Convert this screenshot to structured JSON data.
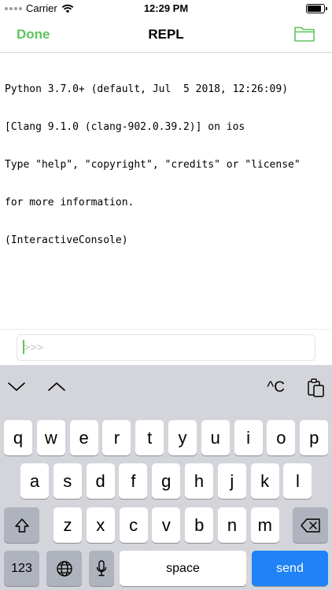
{
  "status_bar": {
    "carrier": "Carrier",
    "time": "12:29 PM",
    "battery_level": 0.95
  },
  "nav": {
    "done_label": "Done",
    "title": "REPL",
    "folder_icon": "folder-icon"
  },
  "console": {
    "lines": [
      "Python 3.7.0+ (default, Jul  5 2018, 12:26:09)",
      "[Clang 9.1.0 (clang-902.0.39.2)] on ios",
      "Type \"help\", \"copyright\", \"credits\" or \"license\"",
      "for more information.",
      "(InteractiveConsole)"
    ]
  },
  "input": {
    "prompt": ">>>"
  },
  "keyboard_toolbar": {
    "ctrl_c_label": "^C"
  },
  "keyboard": {
    "row1": [
      "q",
      "w",
      "e",
      "r",
      "t",
      "y",
      "u",
      "i",
      "o",
      "p"
    ],
    "row2": [
      "a",
      "s",
      "d",
      "f",
      "g",
      "h",
      "j",
      "k",
      "l"
    ],
    "row3": [
      "z",
      "x",
      "c",
      "v",
      "b",
      "n",
      "m"
    ],
    "numbers_label": "123",
    "space_label": "space",
    "send_label": "send"
  },
  "colors": {
    "accent": "#5fc45c",
    "send": "#1f82f6",
    "keyboard_bg": "#d3d5db"
  }
}
